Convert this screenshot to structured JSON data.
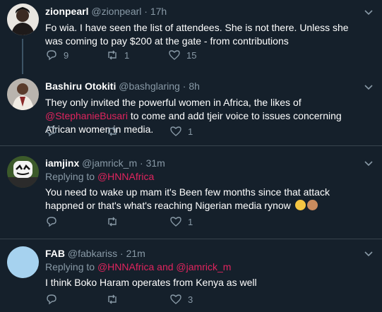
{
  "colors": {
    "background": "#15202b",
    "divider": "#38444d",
    "secondary_text": "#8899a6",
    "mention": "#e0245e"
  },
  "tweets": [
    {
      "name": "zionpearl",
      "handle": "@zionpearl",
      "dot": "·",
      "time": "17h",
      "text": "Fo wia. I have seen the list of attendees. She is not there. Unless she was coming to pay $200 at the gate - from contributions",
      "reply_count": "9",
      "retweet_count": "1",
      "like_count": "15"
    },
    {
      "name": "Bashiru Otokiti",
      "handle": "@bashglaring",
      "dot": "·",
      "time": "8h",
      "text_before": "They only invited the powerful women in Africa, the likes of ",
      "mention": "@StephanieBusari",
      "text_after": " to come and add tjeir voice to issues concerning African women in media.",
      "reply_count": "",
      "retweet_count": "",
      "like_count": "1"
    },
    {
      "name": "iamjinx",
      "handle": "@jamrick_m",
      "dot": "·",
      "time": "31m",
      "replying_label": "Replying to ",
      "replying_mention": "@HNNAfrica",
      "text": "You need to wake up mam it's Been few months since that attack happned or that's what's reaching Nigerian media rynow",
      "emojis": [
        "face-with-tears-of-joy-emoji",
        "see-no-evil-monkey-emoji"
      ],
      "reply_count": "",
      "retweet_count": "",
      "like_count": "1"
    },
    {
      "name": "FAB",
      "handle": "@fabkariss",
      "dot": "·",
      "time": "21m",
      "replying_label": "Replying to ",
      "replying_mention_1": "@HNNAfrica",
      "replying_and": " and ",
      "replying_mention_2": "@jamrick_m",
      "text": "I think Boko Haram operates from Kenya as well",
      "reply_count": "",
      "retweet_count": "",
      "like_count": "3"
    }
  ]
}
